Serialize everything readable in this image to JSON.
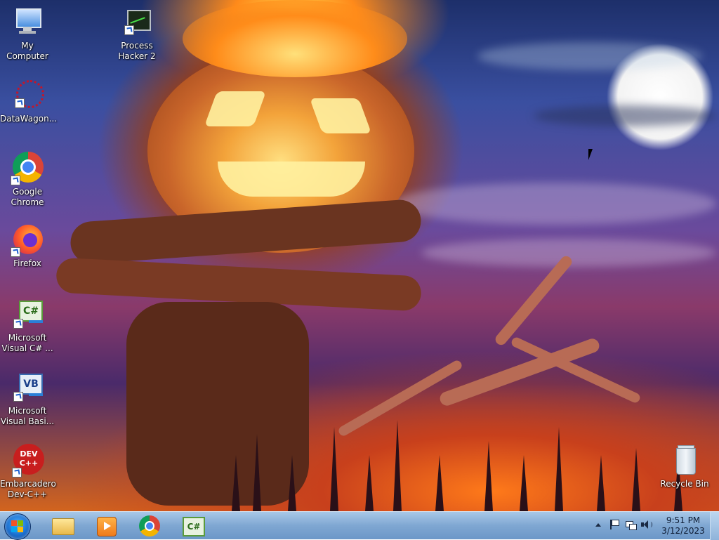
{
  "desktop": {
    "icons": [
      {
        "label": "My Computer",
        "icon": "computer-icon"
      },
      {
        "label": "Process Hacker 2",
        "icon": "process-hacker-icon"
      },
      {
        "label": "DataWagon...",
        "icon": "datawagon-icon"
      },
      {
        "label": "Google Chrome",
        "icon": "chrome-icon"
      },
      {
        "label": "Firefox",
        "icon": "firefox-icon"
      },
      {
        "label": "Microsoft Visual C# ...",
        "icon": "visual-csharp-icon"
      },
      {
        "label": "Microsoft Visual Basi...",
        "icon": "visual-basic-icon"
      },
      {
        "label": "Embarcadero Dev-C++",
        "icon": "devcpp-icon"
      },
      {
        "label": "Recycle Bin",
        "icon": "recycle-bin-icon"
      }
    ],
    "wallpaper": "halloween-pumpkin-wallpaper"
  },
  "taskbar": {
    "start_button": "windows-start-orb",
    "pinned": [
      {
        "name": "windows-explorer",
        "icon": "folder-icon"
      },
      {
        "name": "media-player",
        "icon": "media-player-icon"
      },
      {
        "name": "google-chrome",
        "icon": "chrome-icon"
      },
      {
        "name": "visual-csharp",
        "icon": "visual-csharp-icon"
      }
    ],
    "tray": {
      "icons": [
        "show-hidden-icons-arrow",
        "action-center-flag-icon",
        "network-icon",
        "volume-icon"
      ],
      "time": "9:51 PM",
      "date": "3/12/2023"
    }
  },
  "colors": {
    "taskbar_top": "#a8c8e8",
    "taskbar_bottom": "#6c97c8",
    "chrome_red": "#db4437",
    "chrome_yellow": "#f4b400",
    "chrome_green": "#0f9d58",
    "chrome_blue": "#4285f4"
  }
}
